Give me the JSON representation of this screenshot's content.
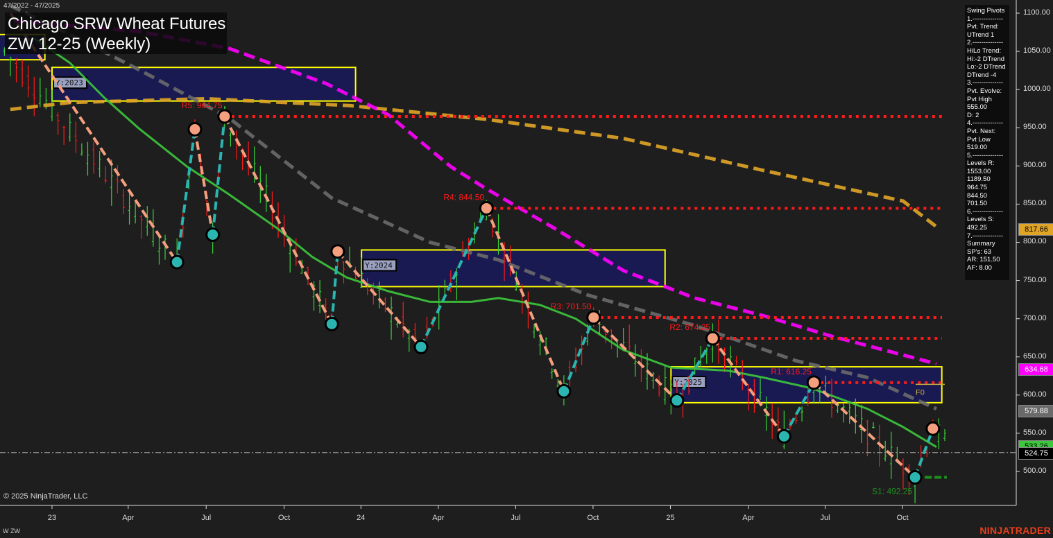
{
  "header": {
    "date_range": "47/2022 - 47/2025",
    "title": "Chicago SRW Wheat Futures",
    "subtitle": "ZW 12-25 (Weekly)"
  },
  "footer": {
    "copyright": "© 2025 NinjaTrader, LLC",
    "symbol": "W ZW",
    "brand": "NINJATRADER"
  },
  "info_panel": {
    "lines": [
      "Swing Pivots",
      "1.--------------",
      "Pvt. Trend:",
      "UTrend 1",
      "2.--------------",
      "HiLo Trend:",
      "Hi:-2 DTrend",
      "Lo:-2 DTrend",
      "DTrend -4",
      "3.--------------",
      "Pvt. Evolve:",
      "Pvt High",
      "555.00",
      "D: 2",
      "4.--------------",
      "Pvt. Next:",
      "Pvt Low",
      "519.00",
      "5.--------------",
      "Levels R:",
      "1553.00",
      "1189.50",
      "964.75",
      "844.50",
      "701.50",
      "6.--------------",
      "Levels S:",
      "492.25",
      "7.--------------",
      "Summary",
      "SP's: 63",
      "AR: 151.50",
      "AF: 8.00"
    ]
  },
  "colors": {
    "background": "#1e1e1e",
    "ma_gold": "#e0a526",
    "ma_magenta": "#ff00ff",
    "ma_gray": "#6a6a6a",
    "ma_green": "#3cc83c",
    "resistance": "#ff1a1a",
    "support": "#1f8f1f",
    "pivot_high": "#f4a07f",
    "pivot_low": "#2bb5b0",
    "year_box_fill": "#1a1a5c",
    "year_box_border": "#ffff00"
  },
  "chart_data": {
    "type": "line",
    "title": "Chicago SRW Wheat Futures ZW 12-25 (Weekly)",
    "x_unit": "weeks since Jan 2023",
    "ylim": [
      450,
      1120
    ],
    "y_ticks": [
      "1100.00",
      "1050.00",
      "1000.00",
      "950.00",
      "900.00",
      "850.00",
      "800.00",
      "750.00",
      "700.00",
      "650.00",
      "600.00",
      "550.00",
      "500.00"
    ],
    "x_ticks": [
      {
        "label": "23",
        "week": 0
      },
      {
        "label": "Apr",
        "week": 12.8
      },
      {
        "label": "Jul",
        "week": 25.9
      },
      {
        "label": "Oct",
        "week": 39
      },
      {
        "label": "24",
        "week": 51.9
      },
      {
        "label": "Apr",
        "week": 64.9
      },
      {
        "label": "Jul",
        "week": 77.9
      },
      {
        "label": "Oct",
        "week": 90.9
      },
      {
        "label": "25",
        "week": 103.9
      },
      {
        "label": "Apr",
        "week": 117
      },
      {
        "label": "Jul",
        "week": 129.9
      },
      {
        "label": "Oct",
        "week": 142.9
      }
    ],
    "price_labels": [
      {
        "value": "817.66",
        "price": 817.66,
        "color": "#e0a526",
        "text": "#000"
      },
      {
        "value": "634.68",
        "price": 634.68,
        "color": "#ff00ff",
        "text": "#fff"
      },
      {
        "value": "579.88",
        "price": 579.88,
        "color": "#6a6a6a",
        "text": "#fff"
      },
      {
        "value": "533.26",
        "price": 533.26,
        "color": "#3cc83c",
        "text": "#000"
      },
      {
        "value": "524.75",
        "price": 524.75,
        "color": "#000000",
        "text": "#fff"
      }
    ],
    "current_price_line": 524.75,
    "series": [
      {
        "name": "MA gold",
        "style": "dashed",
        "color": "#e0a526",
        "points": [
          [
            -7,
            974
          ],
          [
            3,
            983
          ],
          [
            26,
            988
          ],
          [
            50,
            979
          ],
          [
            73,
            961
          ],
          [
            96,
            936
          ],
          [
            119,
            895
          ],
          [
            143,
            854
          ],
          [
            149,
            818
          ]
        ]
      },
      {
        "name": "MA magenta",
        "style": "dashed",
        "color": "#ff00ff",
        "points": [
          [
            -6.4,
            1090
          ],
          [
            14.6,
            1076
          ],
          [
            29.7,
            1054
          ],
          [
            46,
            1008
          ],
          [
            56.5,
            967
          ],
          [
            67,
            899
          ],
          [
            73,
            870
          ],
          [
            84.5,
            818
          ],
          [
            96,
            763
          ],
          [
            108,
            727
          ],
          [
            119.5,
            704
          ],
          [
            131,
            677
          ],
          [
            148.6,
            641
          ]
        ]
      },
      {
        "name": "MA gray",
        "style": "dashed",
        "color": "#6a6a6a",
        "points": [
          [
            -7,
            1110
          ],
          [
            3,
            1072
          ],
          [
            14.6,
            1026
          ],
          [
            29.7,
            963
          ],
          [
            47,
            858
          ],
          [
            63.5,
            800
          ],
          [
            75,
            777
          ],
          [
            90,
            731
          ],
          [
            108,
            691
          ],
          [
            125,
            645
          ],
          [
            137,
            623
          ],
          [
            148.6,
            582
          ]
        ]
      },
      {
        "name": "MA green",
        "style": "solid",
        "color": "#3cc83c",
        "points": [
          [
            -3,
            1067
          ],
          [
            3,
            1035
          ],
          [
            8.7,
            990
          ],
          [
            14.6,
            949
          ],
          [
            22.7,
            899
          ],
          [
            29.7,
            863
          ],
          [
            37.9,
            818
          ],
          [
            43.7,
            781
          ],
          [
            49.5,
            754
          ],
          [
            56.5,
            736
          ],
          [
            63.5,
            722
          ],
          [
            70.5,
            722
          ],
          [
            75,
            727
          ],
          [
            82,
            718
          ],
          [
            88,
            700
          ],
          [
            96,
            659
          ],
          [
            104,
            636
          ],
          [
            113.6,
            632
          ],
          [
            119.5,
            623
          ],
          [
            127.6,
            609
          ],
          [
            137,
            582
          ],
          [
            142.8,
            559
          ],
          [
            148.6,
            532
          ]
        ]
      }
    ],
    "swing_pivots": [
      {
        "week": 21,
        "price": 774,
        "type": "low"
      },
      {
        "week": 24,
        "price": 948,
        "type": "high"
      },
      {
        "week": 27,
        "price": 810,
        "type": "low"
      },
      {
        "week": 29,
        "price": 964.75,
        "type": "high"
      },
      {
        "week": 47,
        "price": 693,
        "type": "low"
      },
      {
        "week": 48,
        "price": 788,
        "type": "high"
      },
      {
        "week": 62,
        "price": 663,
        "type": "low"
      },
      {
        "week": 73,
        "price": 844.5,
        "type": "high"
      },
      {
        "week": 86,
        "price": 605,
        "type": "low"
      },
      {
        "week": 91,
        "price": 701.5,
        "type": "high"
      },
      {
        "week": 105,
        "price": 593,
        "type": "low"
      },
      {
        "week": 111,
        "price": 674.25,
        "type": "high"
      },
      {
        "week": 123,
        "price": 546,
        "type": "low"
      },
      {
        "week": 128,
        "price": 616.25,
        "type": "high"
      },
      {
        "week": 145,
        "price": 492.25,
        "type": "low"
      },
      {
        "week": 148,
        "price": 556,
        "type": "high"
      }
    ],
    "levels": [
      {
        "label": "R5: 964.75",
        "price": 964.75,
        "from_week": 29,
        "kind": "resistance"
      },
      {
        "label": "R4: 844.50",
        "price": 844.5,
        "from_week": 73,
        "kind": "resistance"
      },
      {
        "label": "R3: 701.50",
        "price": 701.5,
        "from_week": 91,
        "kind": "resistance"
      },
      {
        "label": "R2: 674.25",
        "price": 674.25,
        "from_week": 111,
        "kind": "resistance"
      },
      {
        "label": "R1: 616.25",
        "price": 616.25,
        "from_week": 128,
        "kind": "resistance"
      },
      {
        "label": "S1: 492.25",
        "price": 492.25,
        "from_week": 145,
        "kind": "support"
      }
    ],
    "year_boxes": [
      {
        "label": "",
        "from_week": -9,
        "to_week": -1.2,
        "high": 1072,
        "low": 1039
      },
      {
        "label": "Y:2023",
        "from_week": 0,
        "to_week": 51,
        "high": 1029,
        "low": 985
      },
      {
        "label": "Y:2024",
        "from_week": 52,
        "to_week": 103,
        "high": 790,
        "low": 742
      },
      {
        "label": "Y:2025",
        "from_week": 104,
        "to_week": 149.5,
        "high": 637,
        "low": 590
      }
    ],
    "f0_label": "F0",
    "f0_price": 614
  }
}
